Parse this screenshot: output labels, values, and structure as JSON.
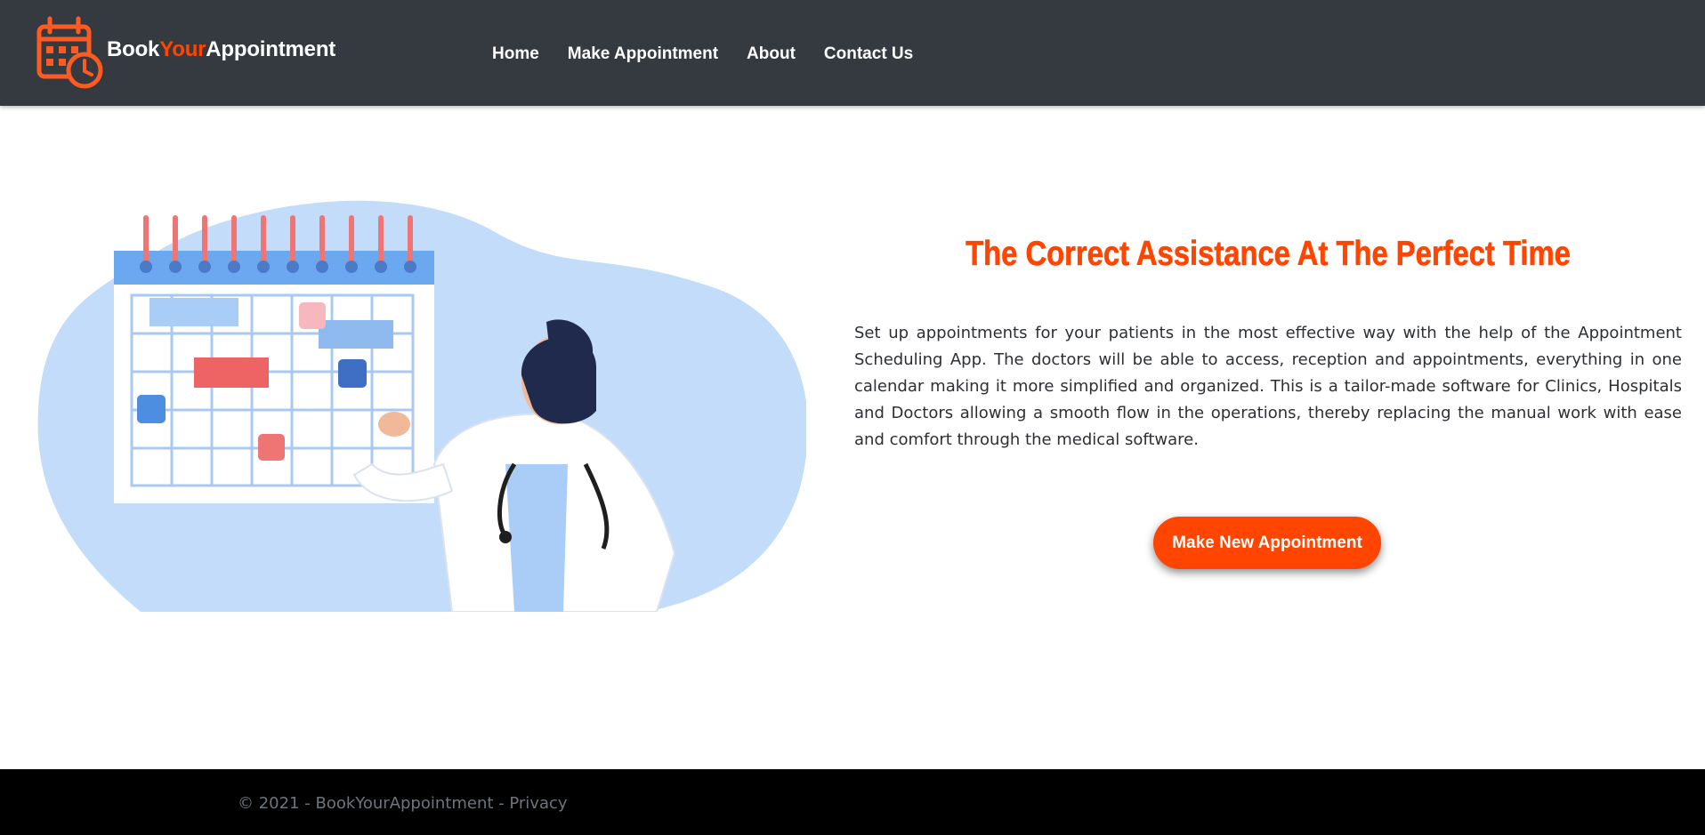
{
  "colors": {
    "accent": "#ff4500",
    "navbar_bg": "#343a40",
    "footer_bg": "#000000",
    "footer_text": "#6c757d",
    "illustration_blue": "#c2dcfa"
  },
  "brand": {
    "prefix": "Book",
    "accent": "Your",
    "suffix": "Appointment",
    "logo_icon": "calendar-clock-icon"
  },
  "nav": {
    "items": [
      {
        "label": "Home"
      },
      {
        "label": "Make Appointment"
      },
      {
        "label": "About"
      },
      {
        "label": "Contact Us"
      }
    ]
  },
  "hero": {
    "headline": "The Correct Assistance At The Perfect Time",
    "description": "Set up appointments for your patients in the most effective way with the help of the Appointment Scheduling App. The doctors will be able to access, reception and appointments, everything in one calendar making it more simplified and organized. This is a tailor-made software for Clinics, Hospitals and Doctors allowing a smooth flow in the operations, thereby replacing the manual work with ease and comfort through the medical software.",
    "cta_label": "Make New Appointment",
    "illustration": "doctor-calendar-illustration"
  },
  "footer": {
    "text": "© 2021 - BookYourAppointment - ",
    "privacy_label": "Privacy"
  }
}
